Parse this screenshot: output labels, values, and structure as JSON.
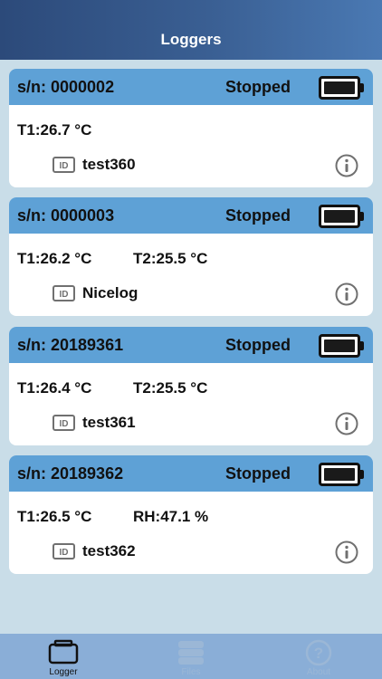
{
  "header": {
    "title": "Loggers"
  },
  "loggers": [
    {
      "sn": "s/n: 0000002",
      "status": "Stopped",
      "t1": "T1:26.7 °C",
      "t2": "",
      "name": "test360"
    },
    {
      "sn": "s/n: 0000003",
      "status": "Stopped",
      "t1": "T1:26.2 °C",
      "t2": "T2:25.5 °C",
      "name": "Nicelog"
    },
    {
      "sn": "s/n: 20189361",
      "status": "Stopped",
      "t1": "T1:26.4 °C",
      "t2": "T2:25.5 °C",
      "name": "test361"
    },
    {
      "sn": "s/n: 20189362",
      "status": "Stopped",
      "t1": "T1:26.5 °C",
      "t2": "RH:47.1 %",
      "name": "test362"
    }
  ],
  "tabs": [
    {
      "label": "Logger",
      "icon": "logger-icon",
      "active": true
    },
    {
      "label": "Files",
      "icon": "files-icon",
      "active": false
    },
    {
      "label": "About",
      "icon": "help-icon",
      "active": false
    }
  ],
  "colors": {
    "header_start": "#2c4a7a",
    "header_end": "#4a79b3",
    "card_head": "#5ea1d6",
    "background": "#c9dde8",
    "tabbar": "#8aaed7",
    "battery": "#1a1a1a",
    "icon_gray": "#707070"
  }
}
